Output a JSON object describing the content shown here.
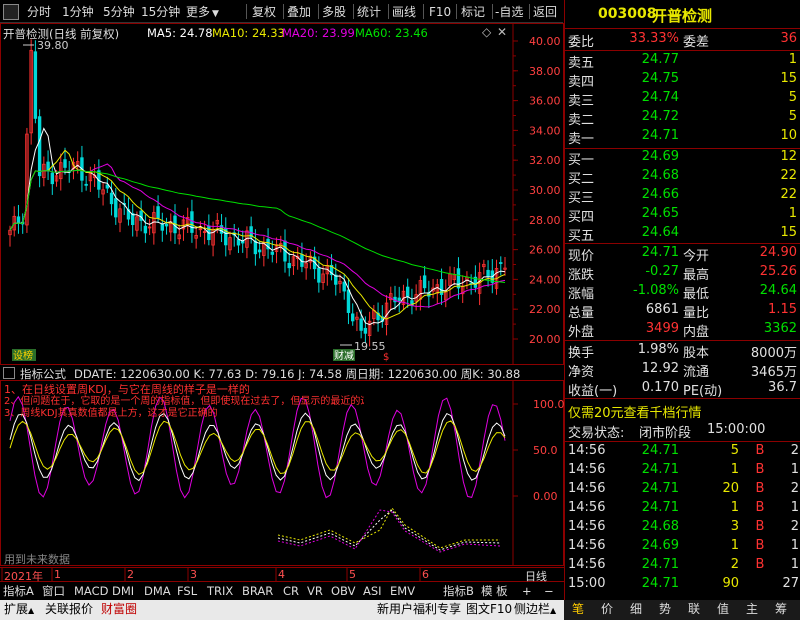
{
  "toolbar": {
    "tabs": [
      "分时",
      "1分钟",
      "5分钟",
      "15分钟",
      "更多"
    ],
    "tools": [
      "复权",
      "叠加",
      "多股",
      "统计",
      "画线",
      "F10",
      "标记",
      "-自选",
      "返回"
    ]
  },
  "main_chart": {
    "name": "开普检测(日线 前复权)",
    "ma5": "MA5: 24.78",
    "ma10": "MA10: 24.33",
    "ma20": "MA20: 23.99",
    "ma60": "MA60: 23.46",
    "y_ticks": [
      "40.00",
      "38.00",
      "36.00",
      "34.00",
      "32.00",
      "30.00",
      "28.00",
      "26.00",
      "24.00",
      "22.00",
      "20.00"
    ],
    "high_label": "39.80",
    "low_label": "19.55",
    "tag_left": "设榜",
    "tag_mid": "财减",
    "tag_red": "$"
  },
  "indicator": {
    "title": "指标公式",
    "values": "DDATE: 1220630.00  K: 77.63  D: 79.16  J: 74.58  周日期: 1220630.00  周K: 30.88",
    "notes": [
      "1、在日线设置周KDJ，与它在周线的样子是一样的",
      "2、但问题在于，它取的是一个周的指标值，但即使现在过去了，但显示的最近的这周",
      "3、周线KDJ其真数值都是上方，这才是它正确的"
    ],
    "y_ticks": [
      "100.0",
      "50.0",
      "0.00"
    ],
    "future_data": "用到未来数据"
  },
  "time_axis": {
    "labels": [
      "2021年",
      "1",
      "2",
      "3",
      "4",
      "5",
      "6"
    ],
    "period": "日线"
  },
  "bottom_tabs": [
    "指标A",
    "窗口",
    "MACD",
    "DMI",
    "DMA",
    "FSL",
    "TRIX",
    "BRAR",
    "CR",
    "VR",
    "OBV",
    "ASI",
    "EMV",
    "指标B",
    "模 板",
    "+",
    "−"
  ],
  "bottom_bar": {
    "left": [
      "扩展",
      "关联报价",
      "财富圈"
    ],
    "promo": "新用户福利专享",
    "right": [
      "图文F10",
      "侧边栏"
    ],
    "icons": [
      "笔",
      "价",
      "细",
      "势",
      "联",
      "值",
      "主",
      "筹"
    ]
  },
  "quote": {
    "code": "003008",
    "name": "开普检测",
    "weibi_label": "委比",
    "weibi": "33.33%",
    "weicha_label": "委差",
    "weicha": "36",
    "asks": [
      {
        "label": "卖五",
        "price": "24.77",
        "vol": "1"
      },
      {
        "label": "卖四",
        "price": "24.75",
        "vol": "15"
      },
      {
        "label": "卖三",
        "price": "24.74",
        "vol": "5"
      },
      {
        "label": "卖二",
        "price": "24.72",
        "vol": "5"
      },
      {
        "label": "卖一",
        "price": "24.71",
        "vol": "10"
      }
    ],
    "bids": [
      {
        "label": "买一",
        "price": "24.69",
        "vol": "12"
      },
      {
        "label": "买二",
        "price": "24.68",
        "vol": "22"
      },
      {
        "label": "买三",
        "price": "24.66",
        "vol": "22"
      },
      {
        "label": "买四",
        "price": "24.65",
        "vol": "1"
      },
      {
        "label": "买五",
        "price": "24.64",
        "vol": "15"
      }
    ],
    "stats": [
      {
        "l1": "现价",
        "v1": "24.71",
        "c1": "g",
        "l2": "今开",
        "v2": "24.90",
        "c2": "r"
      },
      {
        "l1": "涨跌",
        "v1": "-0.27",
        "c1": "g",
        "l2": "最高",
        "v2": "25.26",
        "c2": "r"
      },
      {
        "l1": "涨幅",
        "v1": "-1.08%",
        "c1": "g",
        "l2": "最低",
        "v2": "24.64",
        "c2": "g"
      },
      {
        "l1": "总量",
        "v1": "6861",
        "c1": "w",
        "l2": "量比",
        "v2": "1.15",
        "c2": "r"
      },
      {
        "l1": "外盘",
        "v1": "3499",
        "c1": "r",
        "l2": "内盘",
        "v2": "3362",
        "c2": "g"
      }
    ],
    "stats2": [
      {
        "l1": "换手",
        "v1": "1.98%",
        "l2": "股本",
        "v2": "8000万"
      },
      {
        "l1": "净资",
        "v1": "12.92",
        "l2": "流通",
        "v2": "3465万"
      },
      {
        "l1": "收益(一)",
        "v1": "0.170",
        "l2": "PE(动)",
        "v2": "36.7"
      }
    ],
    "promo": "仅需20元查看千档行情",
    "trade_status_label": "交易状态:",
    "trade_status": "闭市阶段",
    "trade_status_time": "15:00:00",
    "ticks": [
      {
        "t": "14:56",
        "p": "24.71",
        "v": "5",
        "s": "B",
        "n": "2"
      },
      {
        "t": "14:56",
        "p": "24.71",
        "v": "1",
        "s": "B",
        "n": "1"
      },
      {
        "t": "14:56",
        "p": "24.71",
        "v": "20",
        "s": "B",
        "n": "2"
      },
      {
        "t": "14:56",
        "p": "24.71",
        "v": "1",
        "s": "B",
        "n": "1"
      },
      {
        "t": "14:56",
        "p": "24.68",
        "v": "3",
        "s": "B",
        "n": "2"
      },
      {
        "t": "14:56",
        "p": "24.69",
        "v": "1",
        "s": "B",
        "n": "1"
      },
      {
        "t": "14:56",
        "p": "24.71",
        "v": "2",
        "s": "B",
        "n": "1"
      },
      {
        "t": "15:00",
        "p": "24.71",
        "v": "90",
        "s": "",
        "n": "27"
      }
    ]
  },
  "colors": {
    "up": "#ff3232",
    "down": "#00e000",
    "ma5": "#ffffff",
    "ma10": "#e8e800",
    "ma20": "#e000e0",
    "ma60": "#00e000",
    "border": "#8b0000"
  }
}
